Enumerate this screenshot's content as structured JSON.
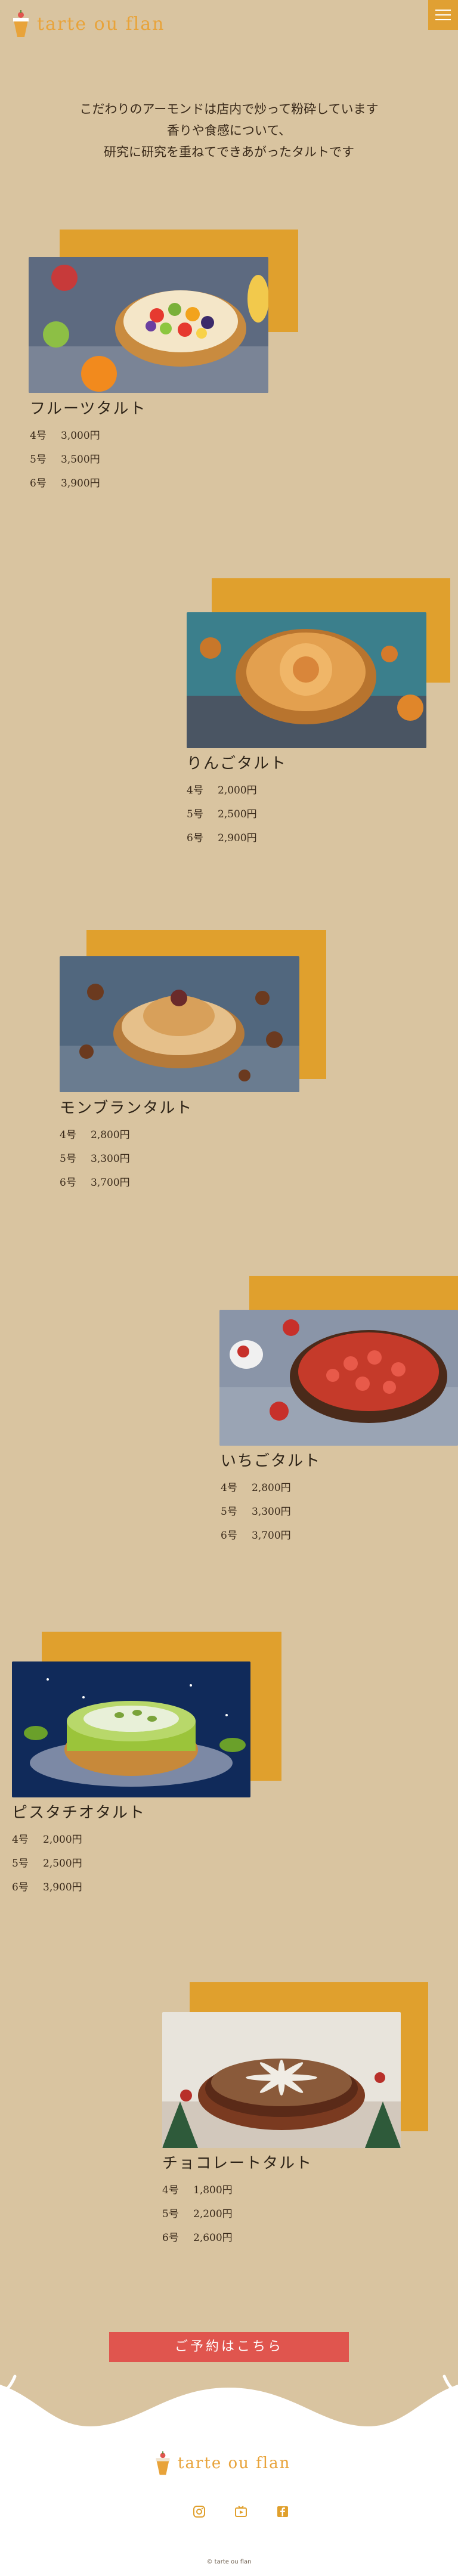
{
  "header": {
    "logo_text": "tarte ou flan",
    "menu_icon": "hamburger-menu-icon"
  },
  "intro": {
    "lines": [
      "こだわりのアーモンドは店内で炒って粉砕しています",
      "香りや食感について、",
      "研究に研究を重ねてできあがったタルトです"
    ]
  },
  "products": [
    {
      "name": "フルーツタルト",
      "prices": [
        {
          "size": "4号",
          "price": "3,000円"
        },
        {
          "size": "5号",
          "price": "3,500円"
        },
        {
          "size": "6号",
          "price": "3,900円"
        }
      ]
    },
    {
      "name": "りんごタルト",
      "prices": [
        {
          "size": "4号",
          "price": "2,000円"
        },
        {
          "size": "5号",
          "price": "2,500円"
        },
        {
          "size": "6号",
          "price": "2,900円"
        }
      ]
    },
    {
      "name": "モンブランタルト",
      "prices": [
        {
          "size": "4号",
          "price": "2,800円"
        },
        {
          "size": "5号",
          "price": "3,300円"
        },
        {
          "size": "6号",
          "price": "3,700円"
        }
      ]
    },
    {
      "name": "いちごタルト",
      "prices": [
        {
          "size": "4号",
          "price": "2,800円"
        },
        {
          "size": "5号",
          "price": "3,300円"
        },
        {
          "size": "6号",
          "price": "3,700円"
        }
      ]
    },
    {
      "name": "ピスタチオタルト",
      "prices": [
        {
          "size": "4号",
          "price": "2,000円"
        },
        {
          "size": "5号",
          "price": "2,500円"
        },
        {
          "size": "6号",
          "price": "3,900円"
        }
      ]
    },
    {
      "name": "チョコレートタルト",
      "prices": [
        {
          "size": "4号",
          "price": "1,800円"
        },
        {
          "size": "5号",
          "price": "2,200円"
        },
        {
          "size": "6号",
          "price": "2,600円"
        }
      ]
    }
  ],
  "reserve_button": {
    "label": "ご予約はこちら"
  },
  "footer": {
    "logo_text": "tarte ou flan",
    "social": [
      "instagram-icon",
      "tv-icon",
      "facebook-icon"
    ],
    "copyright": "© tarte ou flan"
  },
  "colors": {
    "background": "#d9c4a0",
    "accent": "#e0a02d",
    "button": "#e0554e"
  }
}
